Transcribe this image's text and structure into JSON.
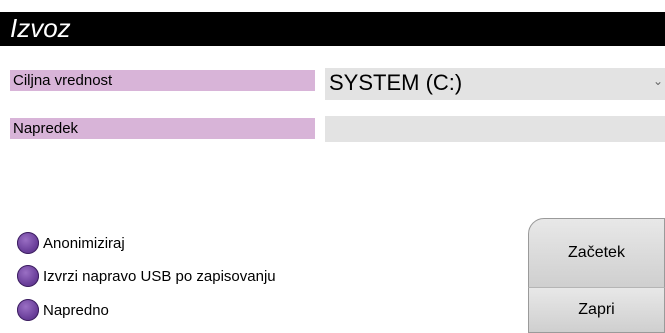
{
  "window": {
    "title": "Izvoz"
  },
  "form": {
    "target_label": "Ciljna vrednost",
    "target_value": "SYSTEM (C:)",
    "progress_label": "Napredek",
    "progress_value": 0
  },
  "options": [
    {
      "label": "Anonimiziraj"
    },
    {
      "label": "Izvrzi napravo USB po zapisovanju"
    },
    {
      "label": "Napredno"
    }
  ],
  "actions": {
    "start_label": "Začetek",
    "close_label": "Zapri"
  },
  "colors": {
    "label_bg": "#d8b4d8",
    "radio": "#6a3f9a",
    "titlebar": "#000000"
  }
}
